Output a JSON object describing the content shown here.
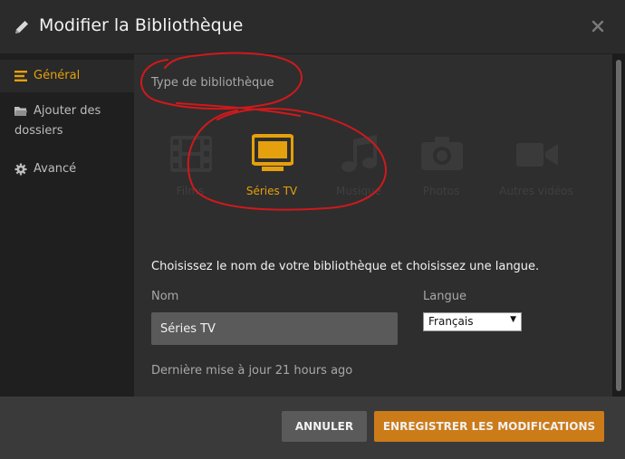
{
  "header": {
    "title": "Modifier la Bibliothèque"
  },
  "sidebar": {
    "items": [
      {
        "label": "Général",
        "icon": "menu-lines-icon",
        "active": true
      },
      {
        "label": "Ajouter des dossiers",
        "label_line1": "Ajouter des",
        "label_line2": "dossiers",
        "icon": "folder-icon"
      },
      {
        "label": "Avancé",
        "icon": "gear-icon"
      }
    ]
  },
  "library_type": {
    "heading": "Type de bibliothèque",
    "options": [
      {
        "label": "Films",
        "icon": "film-icon"
      },
      {
        "label": "Séries TV",
        "icon": "tv-icon",
        "selected": true
      },
      {
        "label": "Musique",
        "icon": "music-icon"
      },
      {
        "label": "Photos",
        "icon": "camera-icon"
      },
      {
        "label": "Autres vidéos",
        "icon": "video-camera-icon"
      }
    ]
  },
  "form": {
    "instruction": "Choisissez le nom de votre bibliothèque et choisissez une langue.",
    "name_label": "Nom",
    "name_value": "Séries TV",
    "language_label": "Langue",
    "language_value": "Français",
    "last_updated": "Dernière mise à jour 21 hours ago"
  },
  "footer": {
    "cancel_label": "ANNULER",
    "save_label": "ENREGISTRER LES MODIFICATIONS"
  },
  "colors": {
    "accent": "#e5a00d",
    "save_button": "#cc7b19",
    "annotation": "#d0191c"
  }
}
